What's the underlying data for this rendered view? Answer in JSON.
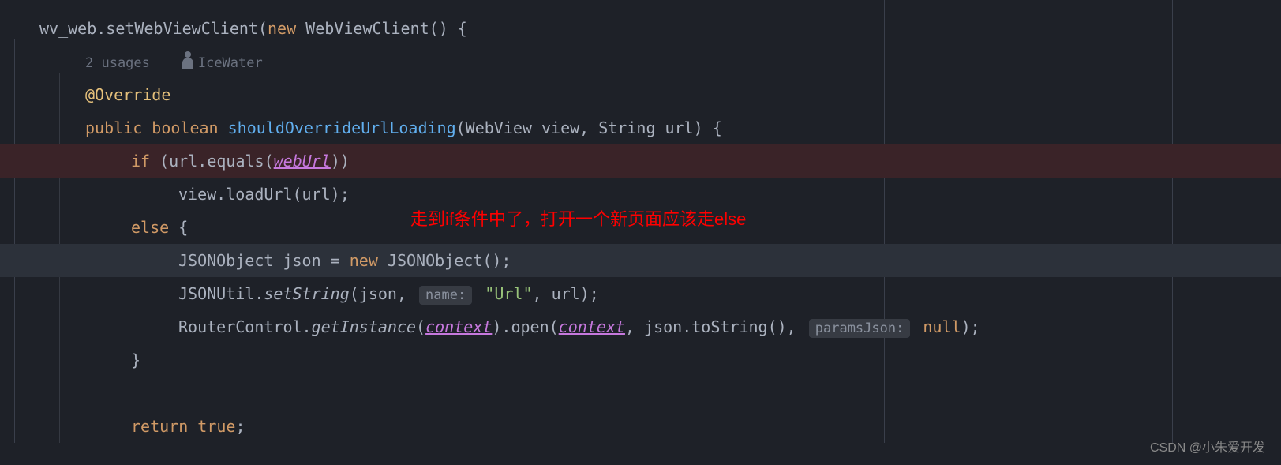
{
  "code": {
    "line1_part1": "wv_web.setWebViewClient(",
    "line1_new": "new",
    "line1_part2": " WebViewClient() {",
    "usages_text": "2 usages",
    "author": "IceWater",
    "override": "@Override",
    "public": "public",
    "boolean": "boolean",
    "method_name": "shouldOverrideUrlLoading",
    "method_params": "(WebView view, String url) {",
    "if_keyword": "if",
    "if_cond_1": " (url.equals(",
    "webUrl": "webUrl",
    "if_cond_2": "))",
    "loadUrl": "view.loadUrl(url);",
    "else_keyword": "else",
    "else_brace": " {",
    "json_line_1": "JSONObject json = ",
    "json_new": "new",
    "json_line_2": " JSONObject();",
    "setString_1": "JSONUtil.",
    "setString_method": "setString",
    "setString_2": "(json, ",
    "name_hint": "name:",
    "url_string": "\"Url\"",
    "setString_3": ", url);",
    "router_1": "RouterControl.",
    "getInstance": "getInstance",
    "router_2": "(",
    "context": "context",
    "router_3": ").open(",
    "router_4": ", json.toString(), ",
    "paramsJson_hint": "paramsJson:",
    "null_kw": "null",
    "router_5": ");",
    "close_brace": "}",
    "return_kw": "return",
    "true_kw": "true",
    "return_semi": ";"
  },
  "annotation": "走到if条件中了，打开一个新页面应该走else",
  "watermark": "CSDN @小朱爱开发"
}
